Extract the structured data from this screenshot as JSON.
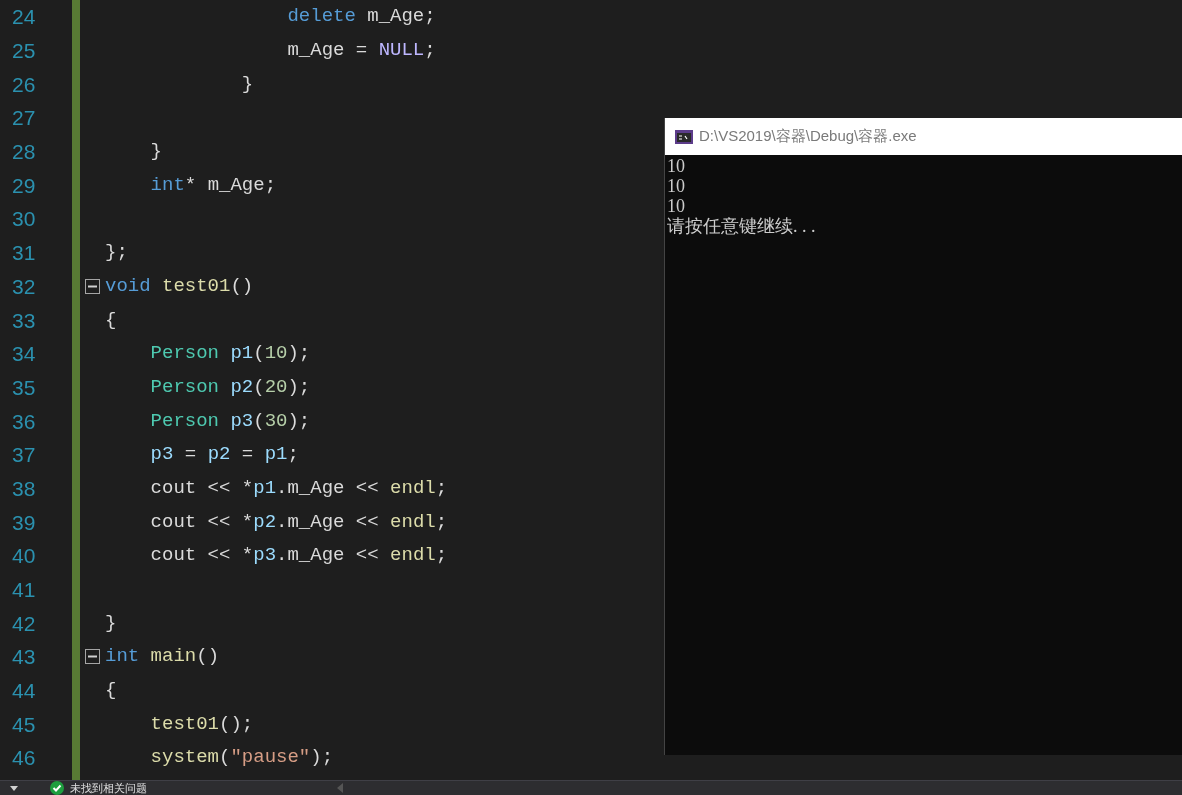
{
  "editor": {
    "lines": [
      {
        "number": "24",
        "fold": false,
        "tokens": [
          {
            "kind": "keyword",
            "text": "                delete"
          },
          {
            "kind": "plain",
            "text": " m_Age;"
          }
        ]
      },
      {
        "number": "25",
        "fold": false,
        "tokens": [
          {
            "kind": "plain",
            "text": "                m_Age = "
          },
          {
            "kind": "macro",
            "text": "NULL"
          },
          {
            "kind": "plain",
            "text": ";"
          }
        ]
      },
      {
        "number": "26",
        "fold": false,
        "tokens": [
          {
            "kind": "plain",
            "text": "            }"
          }
        ]
      },
      {
        "number": "27",
        "fold": false
      },
      {
        "number": "28",
        "fold": false,
        "tokens": [
          {
            "kind": "plain",
            "text": "    }"
          }
        ]
      },
      {
        "number": "29",
        "fold": false,
        "tokens": [
          {
            "kind": "keyword",
            "text": "    int"
          },
          {
            "kind": "plain",
            "text": "* m_Age;"
          }
        ]
      },
      {
        "number": "30",
        "fold": false
      },
      {
        "number": "31",
        "fold": false,
        "tokens": [
          {
            "kind": "plain",
            "text": "};"
          }
        ]
      },
      {
        "number": "32",
        "fold": true,
        "tokens": [
          {
            "kind": "keyword",
            "text": "void"
          },
          {
            "kind": "function",
            "text": " test01"
          },
          {
            "kind": "plain",
            "text": "()"
          }
        ]
      },
      {
        "number": "33",
        "fold": false,
        "tokens": [
          {
            "kind": "plain",
            "text": "{"
          }
        ]
      },
      {
        "number": "34",
        "fold": false,
        "tokens": [
          {
            "kind": "type",
            "text": "    Person"
          },
          {
            "kind": "variable",
            "text": " p1"
          },
          {
            "kind": "plain",
            "text": "("
          },
          {
            "kind": "number",
            "text": "10"
          },
          {
            "kind": "plain",
            "text": ");"
          }
        ]
      },
      {
        "number": "35",
        "fold": false,
        "tokens": [
          {
            "kind": "type",
            "text": "    Person"
          },
          {
            "kind": "variable",
            "text": " p2"
          },
          {
            "kind": "plain",
            "text": "("
          },
          {
            "kind": "number",
            "text": "20"
          },
          {
            "kind": "plain",
            "text": ");"
          }
        ]
      },
      {
        "number": "36",
        "fold": false,
        "tokens": [
          {
            "kind": "type",
            "text": "    Person"
          },
          {
            "kind": "variable",
            "text": " p3"
          },
          {
            "kind": "plain",
            "text": "("
          },
          {
            "kind": "number",
            "text": "30"
          },
          {
            "kind": "plain",
            "text": ");"
          }
        ]
      },
      {
        "number": "37",
        "fold": false,
        "tokens": [
          {
            "kind": "variable",
            "text": "    p3"
          },
          {
            "kind": "plain",
            "text": " = "
          },
          {
            "kind": "variable",
            "text": "p2"
          },
          {
            "kind": "plain",
            "text": " = "
          },
          {
            "kind": "variable",
            "text": "p1"
          },
          {
            "kind": "plain",
            "text": ";"
          }
        ]
      },
      {
        "number": "38",
        "fold": false,
        "tokens": [
          {
            "kind": "plain",
            "text": "    cout << *"
          },
          {
            "kind": "variable",
            "text": "p1"
          },
          {
            "kind": "plain",
            "text": ".m_Age << "
          },
          {
            "kind": "function",
            "text": "endl"
          },
          {
            "kind": "plain",
            "text": ";"
          }
        ]
      },
      {
        "number": "39",
        "fold": false,
        "tokens": [
          {
            "kind": "plain",
            "text": "    cout << *"
          },
          {
            "kind": "variable",
            "text": "p2"
          },
          {
            "kind": "plain",
            "text": ".m_Age << "
          },
          {
            "kind": "function",
            "text": "endl"
          },
          {
            "kind": "plain",
            "text": ";"
          }
        ]
      },
      {
        "number": "40",
        "fold": false,
        "tokens": [
          {
            "kind": "plain",
            "text": "    cout << *"
          },
          {
            "kind": "variable",
            "text": "p3"
          },
          {
            "kind": "plain",
            "text": ".m_Age << "
          },
          {
            "kind": "function",
            "text": "endl"
          },
          {
            "kind": "plain",
            "text": ";"
          }
        ]
      },
      {
        "number": "41",
        "fold": false
      },
      {
        "number": "42",
        "fold": false,
        "tokens": [
          {
            "kind": "plain",
            "text": "}"
          }
        ]
      },
      {
        "number": "43",
        "fold": true,
        "tokens": [
          {
            "kind": "keyword",
            "text": "int"
          },
          {
            "kind": "function",
            "text": " main"
          },
          {
            "kind": "plain",
            "text": "()"
          }
        ]
      },
      {
        "number": "44",
        "fold": false,
        "tokens": [
          {
            "kind": "plain",
            "text": "{"
          }
        ]
      },
      {
        "number": "45",
        "fold": false,
        "tokens": [
          {
            "kind": "function",
            "text": "    test01"
          },
          {
            "kind": "plain",
            "text": "();"
          }
        ]
      },
      {
        "number": "46",
        "fold": false,
        "tokens": [
          {
            "kind": "function",
            "text": "    system"
          },
          {
            "kind": "plain",
            "text": "("
          },
          {
            "kind": "string",
            "text": "\"pause\""
          },
          {
            "kind": "plain",
            "text": ");"
          }
        ]
      }
    ]
  },
  "console": {
    "title": "D:\\VS2019\\容器\\Debug\\容器.exe",
    "lines": [
      "10",
      "10",
      "10",
      "请按任意键继续. . ."
    ]
  },
  "status_bar": {
    "message": "未找到相关问题"
  }
}
